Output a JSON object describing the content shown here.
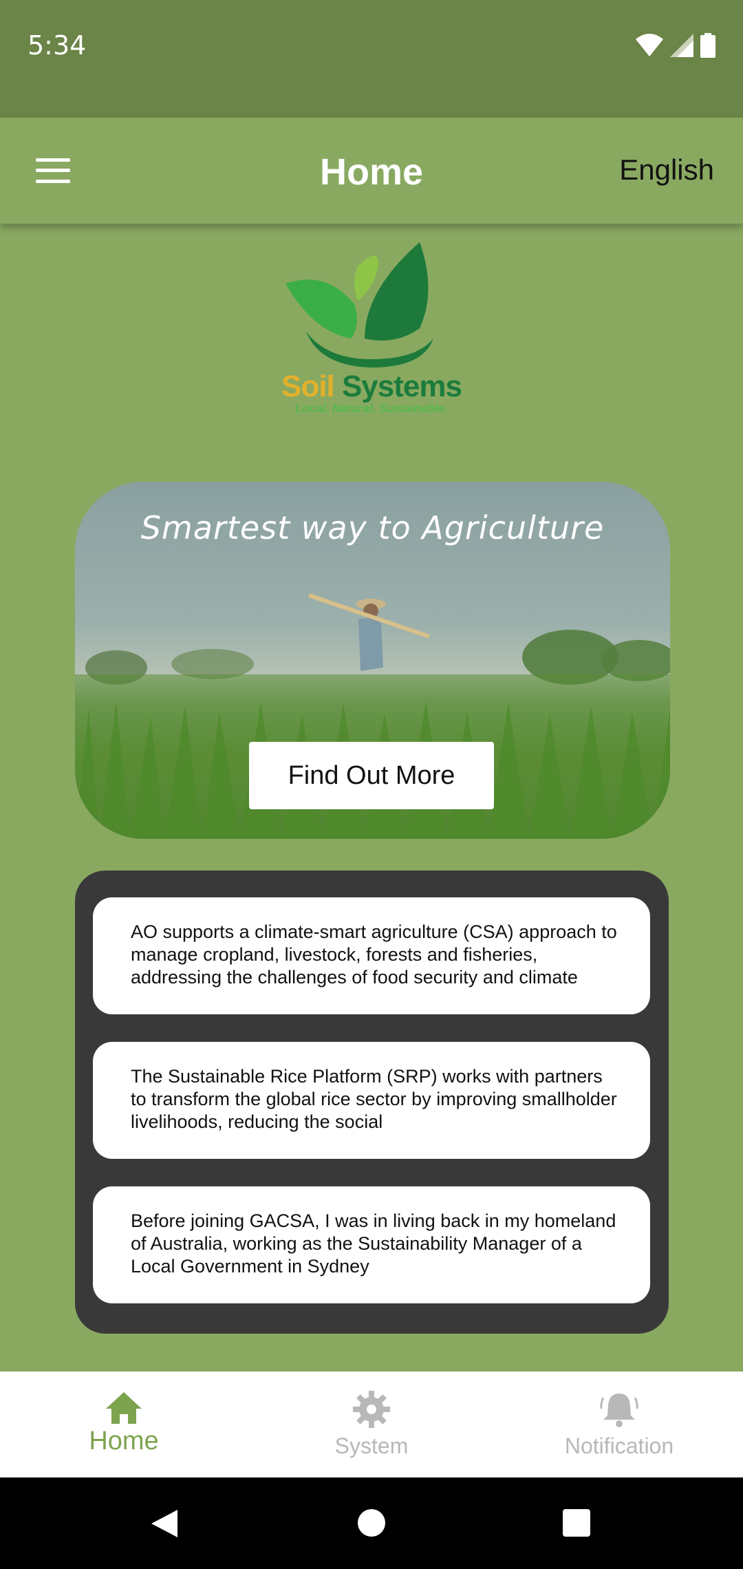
{
  "status_bar": {
    "time": "5:34"
  },
  "app_bar": {
    "title": "Home",
    "language": "English"
  },
  "logo": {
    "brand_part1": "Soil",
    "brand_part2": "Systems",
    "tagline": "Local. Natural. Sustainable."
  },
  "hero": {
    "title": "Smartest way to Agriculture",
    "button_label": "Find Out More"
  },
  "news": [
    {
      "text": "AO supports a climate-smart agriculture (CSA) approach to manage cropland, livestock, forests and fisheries, addressing the challenges of food security and climate"
    },
    {
      "text": "The Sustainable Rice Platform (SRP) works with partners to transform the global rice sector by improving smallholder livelihoods, reducing the social"
    },
    {
      "text": "Before joining GACSA, I was in living back in my homeland of Australia, working as the Sustainability Manager of a Local Government in Sydney"
    }
  ],
  "bottom_nav": [
    {
      "label": "Home",
      "icon": "home-icon",
      "active": true
    },
    {
      "label": "System",
      "icon": "gear-icon",
      "active": false
    },
    {
      "label": "Notification",
      "icon": "bell-icon",
      "active": false
    }
  ],
  "colors": {
    "primary": "#89a961",
    "status_bar": "#6b8447",
    "panel": "#3a393a",
    "nav_active": "#7ea34f",
    "nav_inactive": "#b8b8b8"
  }
}
